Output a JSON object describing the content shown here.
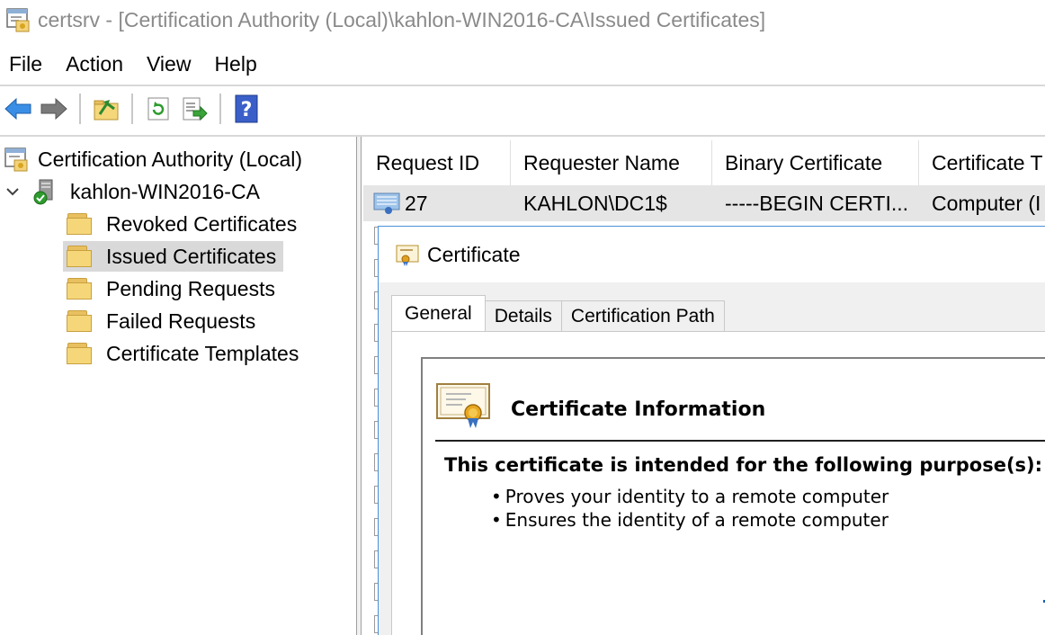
{
  "window": {
    "title": "certsrv - [Certification Authority (Local)\\kahlon-WIN2016-CA\\Issued Certificates]",
    "icon": "certsrv-app-icon"
  },
  "menu": {
    "file": "File",
    "action": "Action",
    "view": "View",
    "help": "Help"
  },
  "toolbar": {
    "icons": [
      "back-arrow-icon",
      "forward-arrow-icon",
      "up-folder-icon",
      "refresh-icon",
      "export-list-icon",
      "help-icon"
    ],
    "help_glyph": "?"
  },
  "tree": {
    "root": "Certification Authority (Local)",
    "ca": "kahlon-WIN2016-CA",
    "items": [
      {
        "label": "Revoked Certificates",
        "selected": false
      },
      {
        "label": "Issued Certificates",
        "selected": true
      },
      {
        "label": "Pending Requests",
        "selected": false
      },
      {
        "label": "Failed Requests",
        "selected": false
      },
      {
        "label": "Certificate Templates",
        "selected": false
      }
    ]
  },
  "list": {
    "columns": [
      "Request ID",
      "Requester Name",
      "Binary Certificate",
      "Certificate T"
    ],
    "rows": [
      {
        "request_id": "27",
        "requester": "KAHLON\\DC1$",
        "binary": "-----BEGIN CERTI...",
        "template": "Computer (I"
      }
    ]
  },
  "dialog": {
    "title": "Certificate",
    "tabs": [
      "General",
      "Details",
      "Certification Path"
    ],
    "active_tab": "General",
    "info_title": "Certificate Information",
    "purpose_heading": "This certificate is intended for the following purpose(s):",
    "purposes": [
      "Proves your identity to a remote computer",
      "Ensures the identity of a remote computer"
    ]
  },
  "colors": {
    "selection": "#d9d9d9",
    "row_highlight": "#e5e5e5",
    "dialog_border": "#4a90d9",
    "title_text": "#8a8a8a"
  }
}
